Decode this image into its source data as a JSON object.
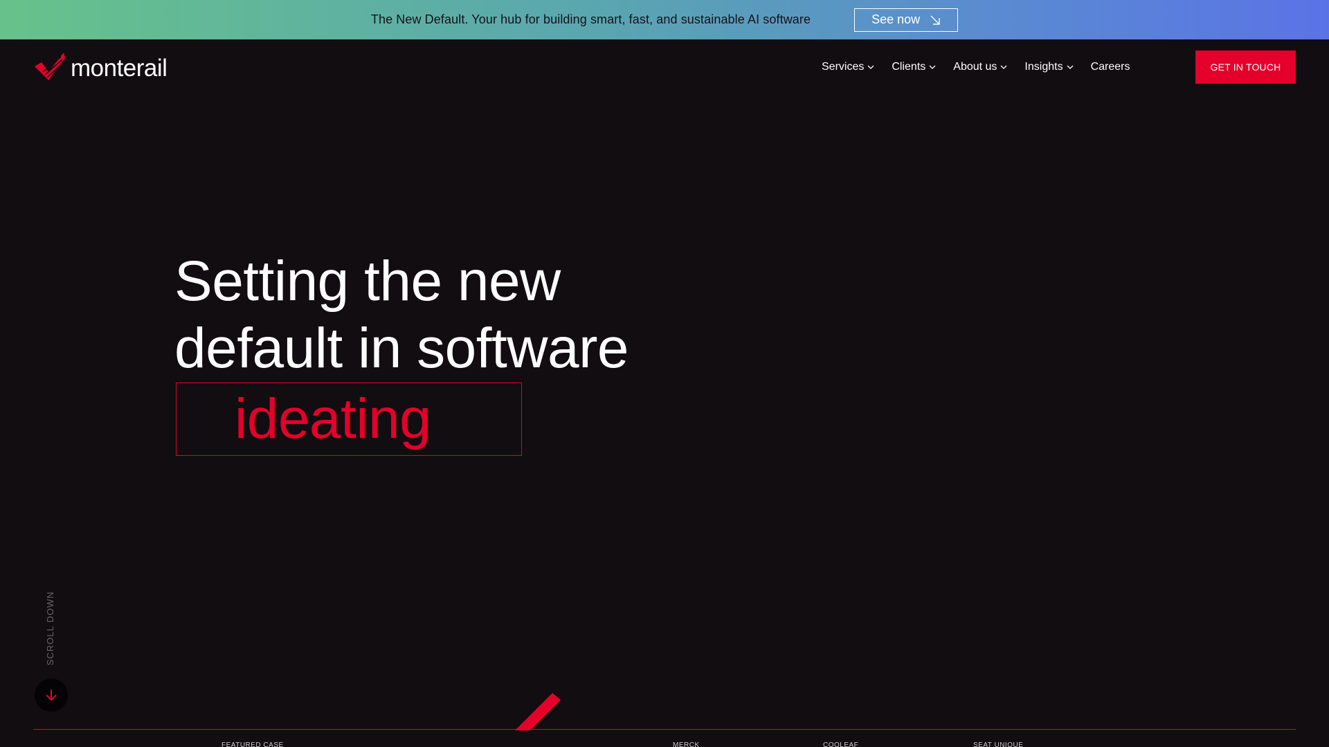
{
  "banner": {
    "text": "The New Default. Your hub for building smart, fast, and sustainable AI software",
    "cta_label": "See now",
    "cta_icon": "arrow-down-right-icon"
  },
  "header": {
    "logo_text": "monterail",
    "logo_icon": "monterail-logo-icon",
    "nav": [
      {
        "label": "Services",
        "has_dropdown": true
      },
      {
        "label": "Clients",
        "has_dropdown": true
      },
      {
        "label": "About us",
        "has_dropdown": true
      },
      {
        "label": "Insights",
        "has_dropdown": true
      },
      {
        "label": "Careers",
        "has_dropdown": false
      }
    ],
    "cta_label": "GET IN TOUCH"
  },
  "hero": {
    "line1": "Setting the new",
    "line2": "default in software",
    "rotating_word": "ideating"
  },
  "scroll": {
    "label": "SCROLL DOWN",
    "icon": "arrow-down-icon"
  },
  "featured": {
    "labels": [
      "FEATURED CASE",
      "MERCK",
      "COOLEAF",
      "SEAT UNIQUE"
    ]
  },
  "colors": {
    "background": "#120d10",
    "accent": "#e4002b",
    "banner_start": "#66c28a",
    "banner_end": "#5b73e6"
  }
}
